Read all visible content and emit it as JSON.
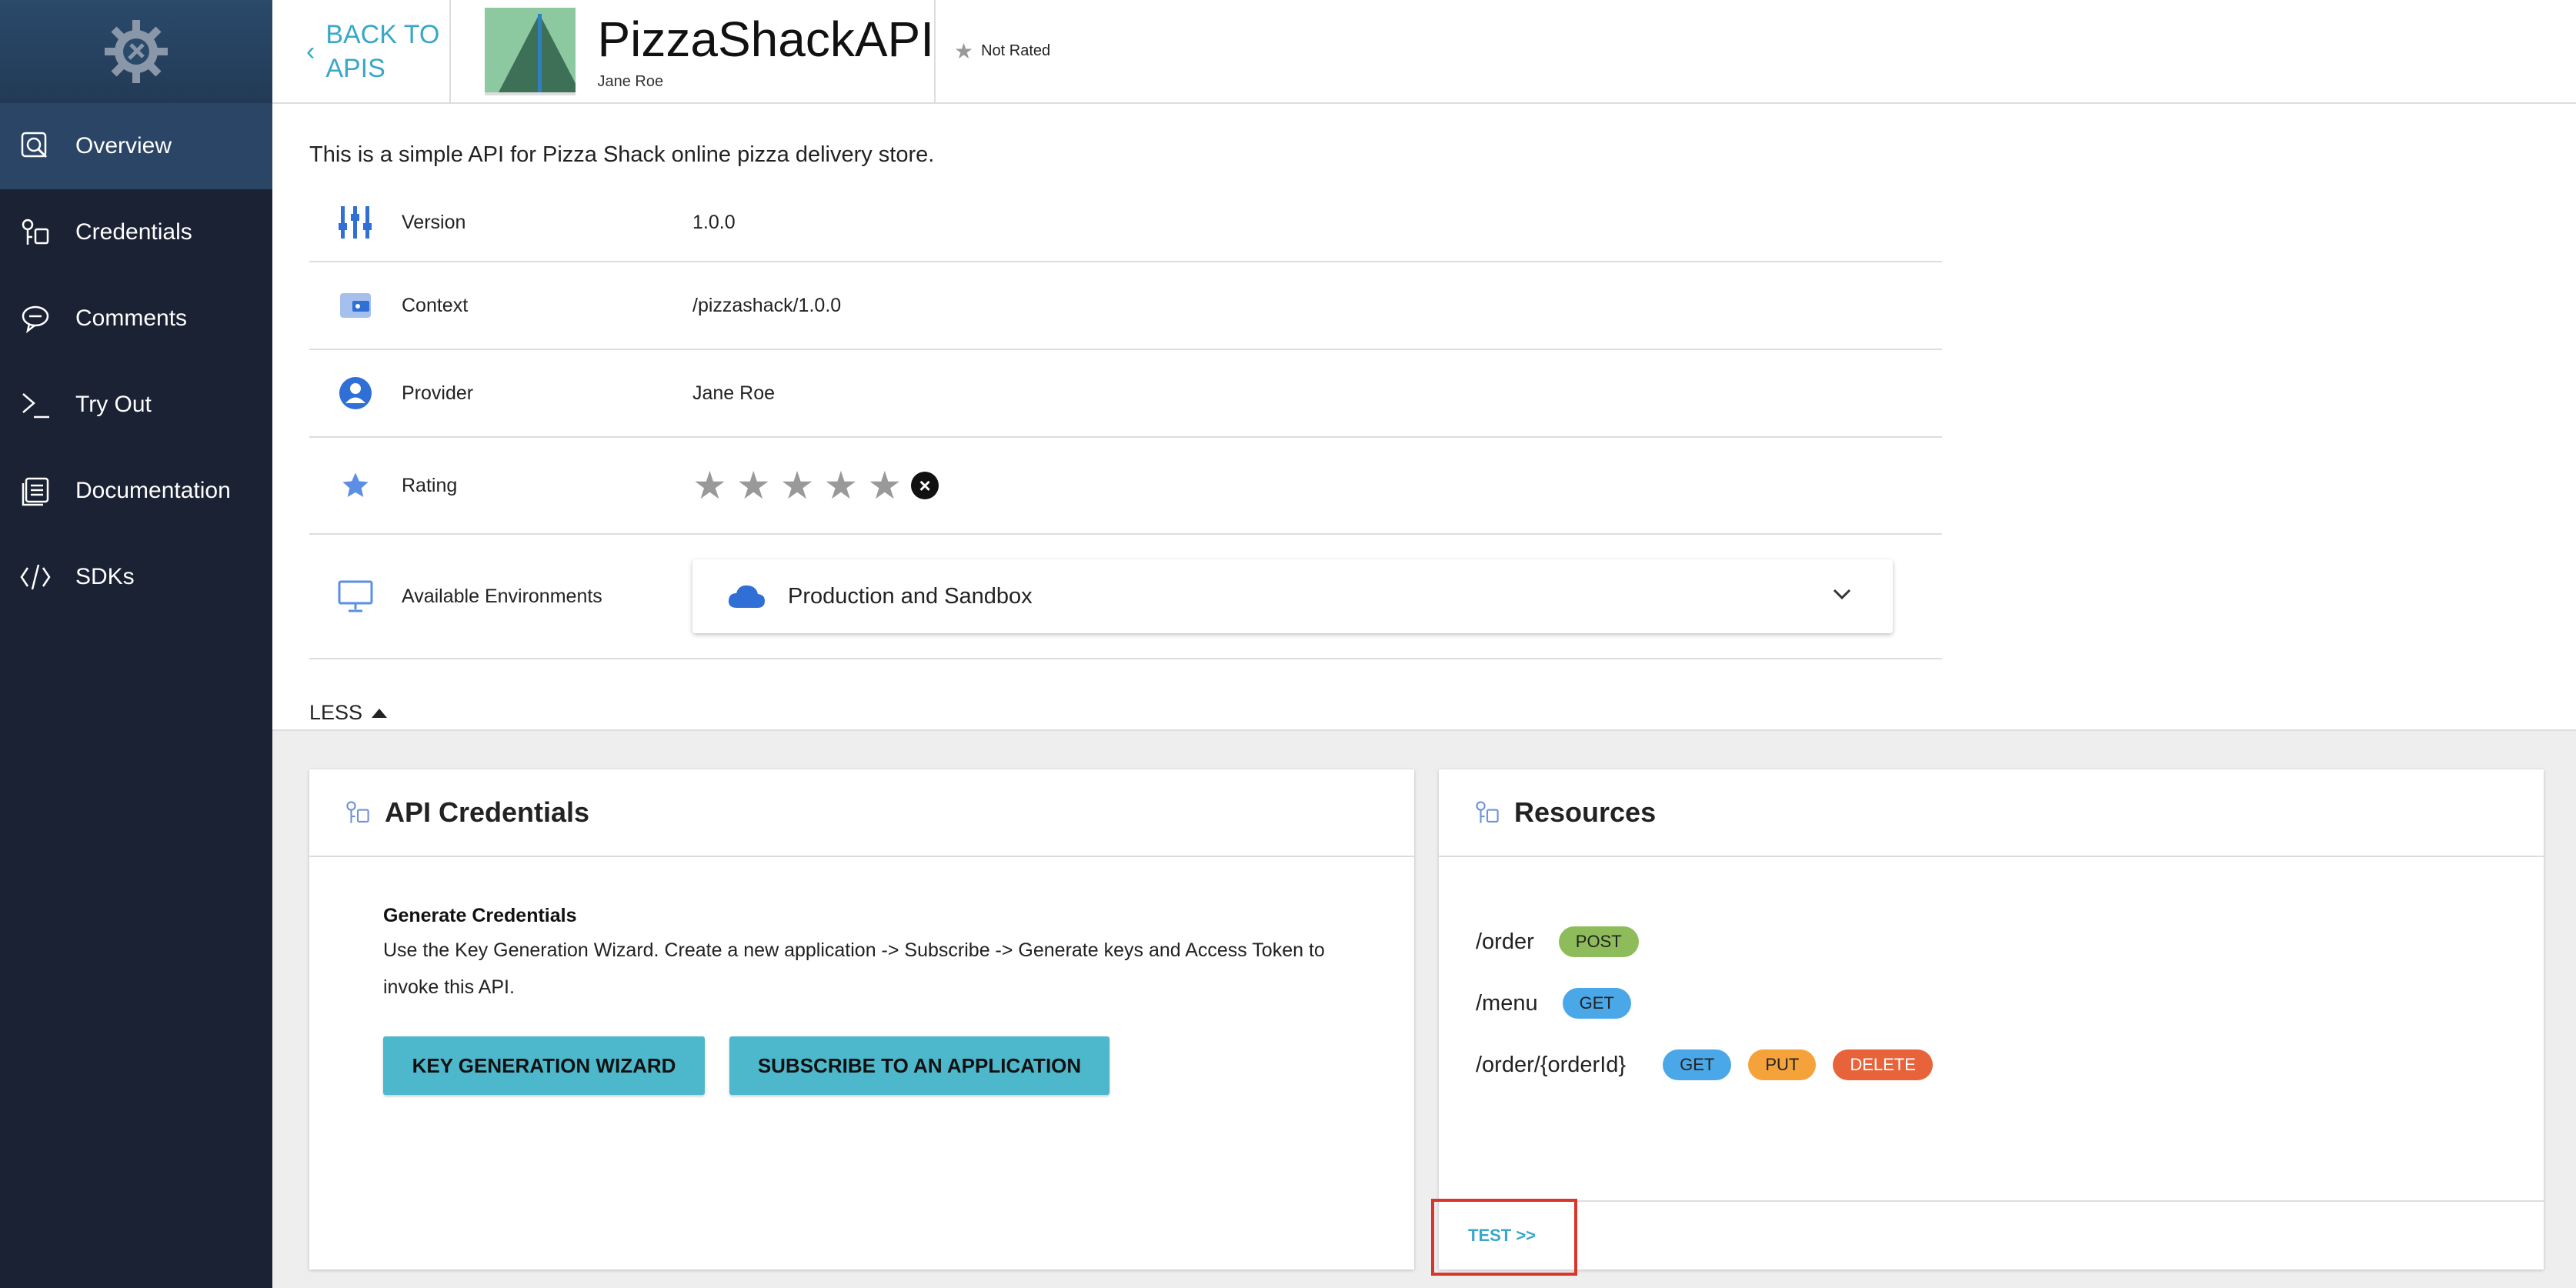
{
  "sidebar": {
    "items": [
      {
        "label": "Overview",
        "icon": "overview-icon",
        "active": true
      },
      {
        "label": "Credentials",
        "icon": "credentials-icon"
      },
      {
        "label": "Comments",
        "icon": "comments-icon"
      },
      {
        "label": "Try Out",
        "icon": "terminal-icon"
      },
      {
        "label": "Documentation",
        "icon": "documentation-icon"
      },
      {
        "label": "SDKs",
        "icon": "code-icon"
      }
    ]
  },
  "header": {
    "back_line1": "BACK TO",
    "back_line2": "APIS",
    "api_name": "PizzaShackAPI",
    "provider": "Jane Roe",
    "rating_text": "Not Rated"
  },
  "overview": {
    "description": "This is a simple API for Pizza Shack online pizza delivery store.",
    "rows": {
      "version": {
        "label": "Version",
        "value": "1.0.0"
      },
      "context": {
        "label": "Context",
        "value": "/pizzashack/1.0.0"
      },
      "provider": {
        "label": "Provider",
        "value": "Jane Roe"
      },
      "rating": {
        "label": "Rating",
        "stars": 0,
        "max": 5
      },
      "environments": {
        "label": "Available Environments",
        "selected": "Production and Sandbox"
      }
    },
    "less_label": "LESS"
  },
  "credentials_card": {
    "title": "API Credentials",
    "heading": "Generate Credentials",
    "description": "Use the Key Generation Wizard. Create a new application -> Subscribe -> Generate keys and Access Token to invoke this API.",
    "btn_wizard": "KEY GENERATION WIZARD",
    "btn_subscribe": "SUBSCRIBE TO AN APPLICATION"
  },
  "resources_card": {
    "title": "Resources",
    "resources": [
      {
        "path": "/order",
        "methods": [
          "POST"
        ]
      },
      {
        "path": "/menu",
        "methods": [
          "GET"
        ]
      },
      {
        "path": "/order/{orderId}",
        "methods": [
          "GET",
          "PUT",
          "DELETE"
        ]
      }
    ],
    "test_link": "TEST >>"
  },
  "colors": {
    "sidebar_bg": "#1a2233",
    "accent": "#39a7c7",
    "button": "#4db8cc",
    "post": "#8fbc5a",
    "get": "#4aa8e8",
    "put": "#f5a23b",
    "delete": "#e8633a",
    "highlight": "#d9362b"
  }
}
